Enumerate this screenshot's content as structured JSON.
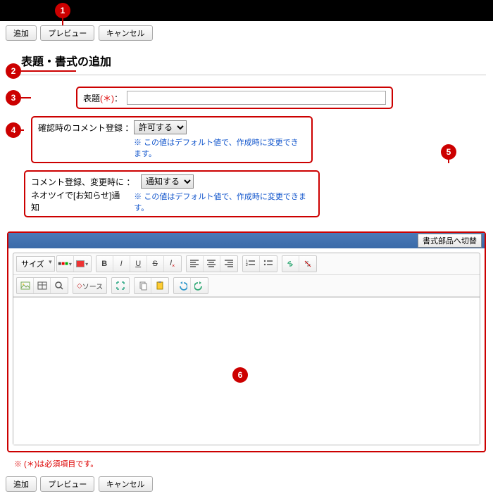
{
  "buttons": {
    "add": "追加",
    "preview": "プレビュー",
    "cancel": "キャンセル"
  },
  "page_title": "表題・書式の追加",
  "row1": {
    "label": "表題",
    "req": "(＊)",
    "colon": "：",
    "value": ""
  },
  "row2": {
    "label": "確認時のコメント登録 ：",
    "select": "許可する",
    "note": "※ この値はデフォルト値で、作成時に変更できます。"
  },
  "row3": {
    "label": "コメント登録、変更時に ：",
    "select": "通知する",
    "sub": "ネオツイで[お知らせ]通知",
    "note": "※ この値はデフォルト値で、作成時に変更できます。"
  },
  "switch_btn": "書式部品へ切替",
  "toolbar": {
    "size_label": "サイズ",
    "source": "ソース"
  },
  "footnote": "※ (＊)は必須項目です。",
  "badges": [
    "1",
    "2",
    "3",
    "4",
    "5",
    "6"
  ]
}
